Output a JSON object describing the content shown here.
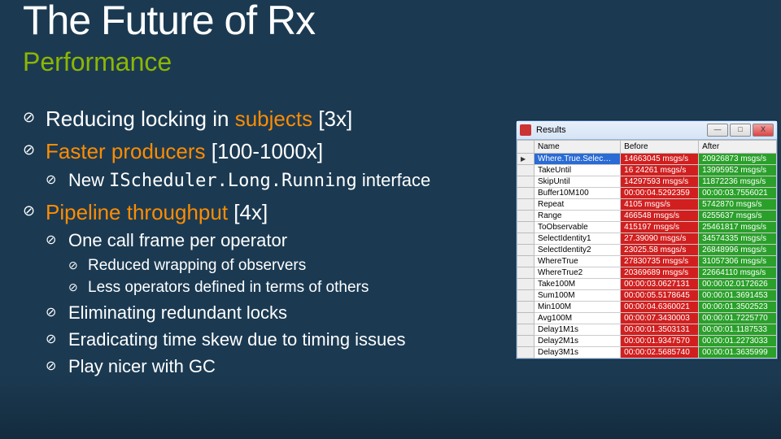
{
  "title": "The Future of Rx",
  "subtitle": "Performance",
  "bullets_lvl1": {
    "b1a": "Reducing locking in ",
    "b1b": "subjects",
    "b1c": " [3x]",
    "b2a": "Faster producers",
    "b2b": " [100-1000x]",
    "b3a": "Pipeline throughput",
    "b3b": " [4x]"
  },
  "bullets_lvl2": {
    "s1a": "New ",
    "s1b": "IScheduler.Long.Running",
    "s1c": " interface",
    "s2": "One call frame per operator",
    "s3": "Eliminating redundant locks",
    "s4": "Eradicating time skew due to timing issues",
    "s5": "Play nicer with GC"
  },
  "bullets_lvl3": {
    "t1": "Reduced wrapping of observers",
    "t2": "Less operators defined in terms of others"
  },
  "win": {
    "title": "Results",
    "min": "—",
    "max": "□",
    "close": "X",
    "cols": {
      "name": "Name",
      "before": "Before",
      "after": "After"
    }
  },
  "chart_data": {
    "type": "table",
    "title": "Results",
    "columns": [
      "Name",
      "Before",
      "After"
    ],
    "units": "msgs/s or elapsed time (hh:mm:ss.fffffff) as shown",
    "rows": [
      {
        "name": "Where.True.Selec…",
        "before": "14663045 msgs/s",
        "after": "20926873 msgs/s",
        "selected": true
      },
      {
        "name": "TakeUntil",
        "before": "16  24261 msgs/s",
        "after": "13995952 msgs/s"
      },
      {
        "name": "SkipUntil",
        "before": "14297593 msgs/s",
        "after": "11872236 msgs/s"
      },
      {
        "name": "Buffer10M100",
        "before": "00:00:04.5292359",
        "after": "00:00:03.7556021"
      },
      {
        "name": "Repeat",
        "before": "4105 msgs/s",
        "after": "5742870 msgs/s"
      },
      {
        "name": "Range",
        "before": "466548 msgs/s",
        "after": "6255637 msgs/s"
      },
      {
        "name": "ToObservable",
        "before": "415197 msgs/s",
        "after": "25461817 msgs/s"
      },
      {
        "name": "SelectIdentity1",
        "before": "27.39090 msgs/s",
        "after": "34574335 msgs/s"
      },
      {
        "name": "SelectIdentity2",
        "before": "23025.58 msgs/s",
        "after": "26848996 msgs/s"
      },
      {
        "name": "WhereTrue",
        "before": "27830735 msgs/s",
        "after": "31057306 msgs/s"
      },
      {
        "name": "WhereTrue2",
        "before": "20369689 msgs/s",
        "after": "22664110 msgs/s"
      },
      {
        "name": "Take100M",
        "before": "00:00:03.0627131",
        "after": "00:00:02.0172626"
      },
      {
        "name": "Sum100M",
        "before": "00:00:05.5178645",
        "after": "00:00:01.3691453"
      },
      {
        "name": "Min100M",
        "before": "00:00:04.6360021",
        "after": "00:00:01.3502523"
      },
      {
        "name": "Avg100M",
        "before": "00:00:07.3430003",
        "after": "00:00:01.7225770"
      },
      {
        "name": "Delay1M1s",
        "before": "00:00:01.3503131",
        "after": "00:00:01.1187533"
      },
      {
        "name": "Delay2M1s",
        "before": "00:00:01.9347570",
        "after": "00:00:01.2273033"
      },
      {
        "name": "Delay3M1s",
        "before": "00:00:02.5685740",
        "after": "00:00:01.3635999"
      }
    ]
  }
}
